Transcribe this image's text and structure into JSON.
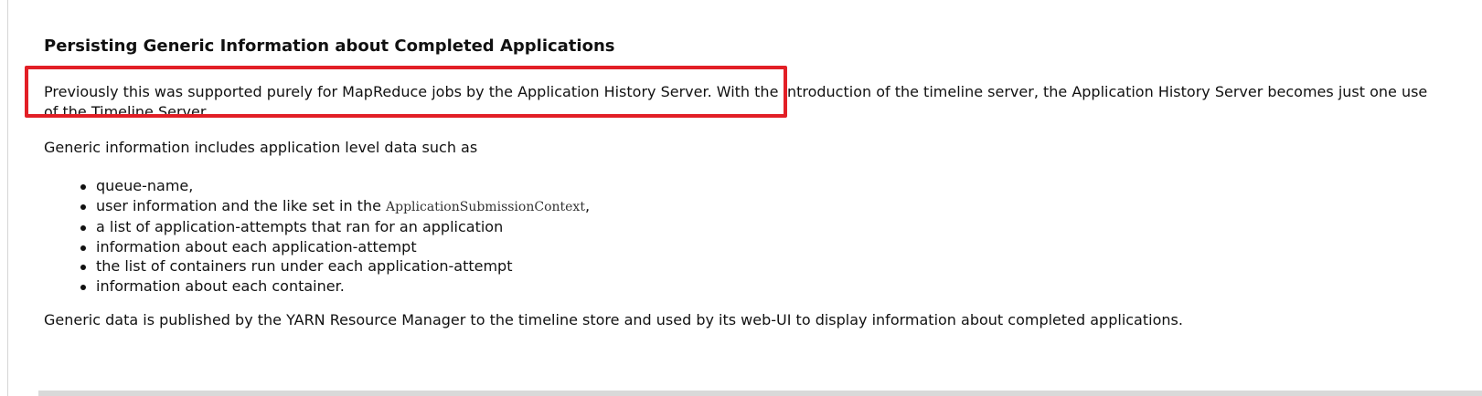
{
  "section": {
    "title": "Persisting Generic Information about Completed Applications",
    "intro": "Previously this was supported purely for MapReduce jobs by the Application History Server. With the introduction of the timeline server, the Application History Server becomes just one use of the Timeline Server.",
    "lead": "Generic information includes application level data such as",
    "items": [
      {
        "text": "queue-name,",
        "code": "",
        "suffix": ""
      },
      {
        "text": "user information and the like set in the ",
        "code": "ApplicationSubmissionContext",
        "suffix": ","
      },
      {
        "text": "a list of application-attempts that ran for an application",
        "code": "",
        "suffix": ""
      },
      {
        "text": "information about each application-attempt",
        "code": "",
        "suffix": ""
      },
      {
        "text": "the list of containers run under each application-attempt",
        "code": "",
        "suffix": ""
      },
      {
        "text": "information about each container.",
        "code": "",
        "suffix": ""
      }
    ],
    "closing": "Generic data is published by the YARN Resource Manager to the timeline store and used by its web-UI to display information about completed applications."
  },
  "annotation": {
    "color": "#e21f26"
  }
}
